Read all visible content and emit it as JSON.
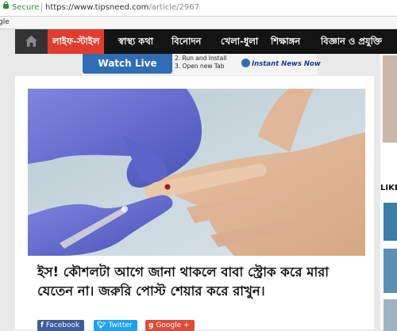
{
  "browser": {
    "secure_label": "Secure",
    "url_host": "https://www.tipsneed.com",
    "url_path": "/article/2967",
    "bookmark_fragment": "gle"
  },
  "nav": {
    "items": [
      {
        "label": "লাইফ-স্টাইল",
        "active": true
      },
      {
        "label": "স্বাস্থ্য কথা"
      },
      {
        "label": "বিনোদন"
      },
      {
        "label": "খেলা-ধুলা"
      },
      {
        "label": "শিক্ষাঙ্গন"
      },
      {
        "label": "বিজ্ঞান ও প্রযুক্তি"
      }
    ],
    "active_color": "#e23c2f",
    "bar_color": "#141414"
  },
  "ad": {
    "button_label": "Watch Live",
    "step2": "2. Run and Install",
    "step3": "3. Open new Tab",
    "brand": "Instant News Now"
  },
  "article": {
    "headline": "ইস! কৌশলটা আগে জানা থাকলে বাবা স্ট্রোক করে মারা যেতেন না। জরুরি পোস্ট শেয়ার করে রাখুন।",
    "image_desc_icon": "finger-prick-photo"
  },
  "share": {
    "facebook": "Facebook",
    "twitter": "Twitter",
    "google": "Google +",
    "facebook_color": "#3b5b99",
    "twitter_color": "#1da1f2",
    "google_color": "#dd4b39"
  },
  "sidebar": {
    "heading": "LIKE O"
  }
}
